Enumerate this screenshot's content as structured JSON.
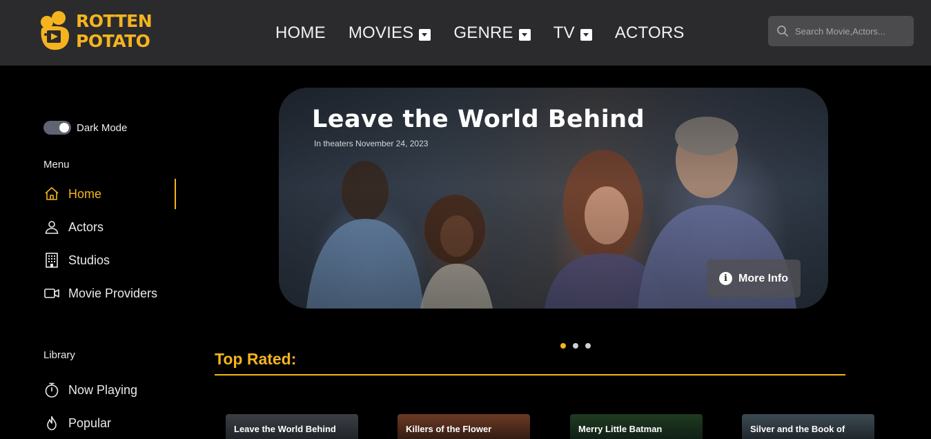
{
  "brand": {
    "line1": "ROTTEN",
    "line2": "POTATO",
    "color": "#f5b41e"
  },
  "nav": {
    "items": [
      {
        "label": "HOME",
        "dropdown": false
      },
      {
        "label": "MOVIES",
        "dropdown": true
      },
      {
        "label": "GENRE",
        "dropdown": true
      },
      {
        "label": "TV",
        "dropdown": true
      },
      {
        "label": "ACTORS",
        "dropdown": false
      }
    ]
  },
  "search": {
    "placeholder": "Search Movie,Actors...",
    "icon": "search-icon"
  },
  "sidebar": {
    "dark_mode_label": "Dark Mode",
    "dark_mode_on": true,
    "menu_title": "Menu",
    "menu": [
      {
        "label": "Home",
        "icon": "home-icon",
        "active": true
      },
      {
        "label": "Actors",
        "icon": "user-icon",
        "active": false
      },
      {
        "label": "Studios",
        "icon": "building-icon",
        "active": false
      },
      {
        "label": "Movie Providers",
        "icon": "video-camera-icon",
        "active": false
      }
    ],
    "library_title": "Library",
    "library": [
      {
        "label": "Now Playing",
        "icon": "stopwatch-icon"
      },
      {
        "label": "Popular",
        "icon": "flame-icon"
      }
    ]
  },
  "hero": {
    "title": "Leave the World Behind",
    "subtitle": "In theaters November 24, 2023",
    "more_info_label": "More Info",
    "slides_total": 3,
    "active_slide": 1
  },
  "top_rated": {
    "title": "Top Rated:",
    "cards": [
      {
        "title": "Leave the World Behind"
      },
      {
        "title": "Killers of the Flower"
      },
      {
        "title": "Merry Little Batman"
      },
      {
        "title": "Silver and the Book of"
      }
    ]
  },
  "colors": {
    "accent": "#f5b41e",
    "header_bg": "#2b2b2d",
    "page_bg": "#000000"
  }
}
